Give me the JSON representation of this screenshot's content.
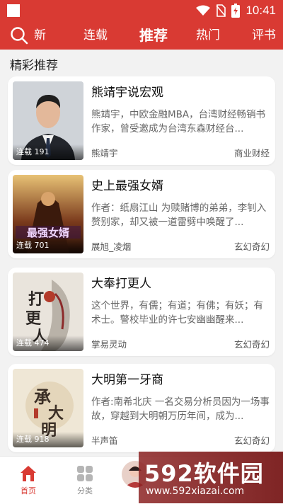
{
  "status": {
    "time": "10:41"
  },
  "nav": {
    "tabs": [
      {
        "label": "新"
      },
      {
        "label": "连载"
      },
      {
        "label": "推荐"
      },
      {
        "label": "热门"
      },
      {
        "label": "评书"
      }
    ],
    "active_tab": "推荐",
    "search_icon": "search-icon"
  },
  "section": {
    "title": "精彩推荐"
  },
  "books": [
    {
      "title": "熊靖宇说宏观",
      "description": "熊靖宇，中欧金融MBA，台湾财经畅销书作家，曾受邀成为台湾东森财经台...",
      "author": "熊靖宇",
      "genre": "商业财经",
      "badge": "连载 191"
    },
    {
      "title": "史上最强女婿",
      "description": "作者：纸扇江山 为赎赌博的弟弟，李钊入赘别家，却又被一道雷劈中唤醒了...",
      "author": "展旭_凌烟",
      "genre": "玄幻奇幻",
      "badge": "连载 701"
    },
    {
      "title": "大奉打更人",
      "description": "这个世界，有儒；有道；有佛；有妖；有术士。警校毕业的许七安幽幽醒来...",
      "author": "掌易灵动",
      "genre": "玄幻奇幻",
      "badge": "连载 474"
    },
    {
      "title": "大明第一牙商",
      "description": "作者:南希北庆 一名交易分析员因为一场事故，穿越到大明朝万历年间，成为...",
      "author": "半声笛",
      "genre": "玄幻奇幻",
      "badge": "连载 918"
    }
  ],
  "tabbar": {
    "items": [
      {
        "label": "首页",
        "icon": "home-icon"
      },
      {
        "label": "分类",
        "icon": "category-icon"
      }
    ]
  },
  "watermark": {
    "logo": "592软件园",
    "url": "www.592xiazai.com"
  },
  "colors": {
    "brand": "#d93a33",
    "text_secondary": "#666666"
  }
}
